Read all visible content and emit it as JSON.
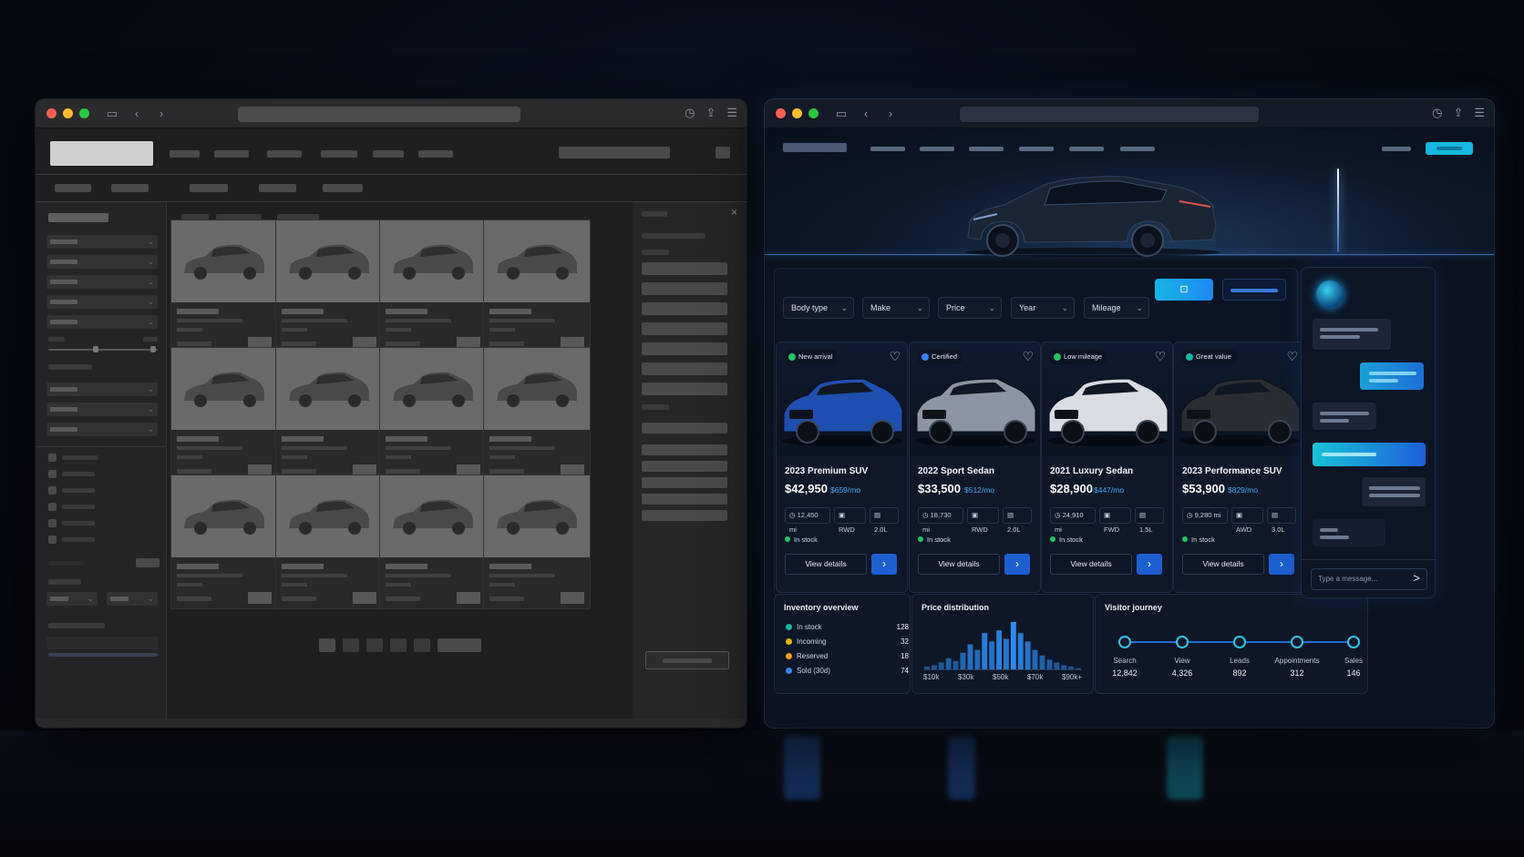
{
  "right_window": {
    "filters": [
      "Body type",
      "Make",
      "Price",
      "Year",
      "Mileage"
    ],
    "cards": [
      {
        "badge": "New arrival",
        "badge_color": "#22c55e",
        "title": "2023 Premium SUV",
        "price": "$42,950",
        "monthly": "$659/mo",
        "mileage": "12,450 mi",
        "drive": "RWD",
        "engine": "2.0L",
        "stock": "In stock",
        "view": "View details",
        "car_color": "#1f4fb0"
      },
      {
        "badge": "Certified",
        "badge_color": "#3b82f6",
        "title": "2022 Sport Sedan",
        "price": "$33,500",
        "monthly": "$512/mo",
        "mileage": "18,730 mi",
        "drive": "RWD",
        "engine": "2.0L",
        "stock": "In stock",
        "view": "View details",
        "car_color": "#8c95a3"
      },
      {
        "badge": "Low mileage",
        "badge_color": "#22c55e",
        "title": "2021 Luxury Sedan",
        "price": "$28,900",
        "monthly": "$447/mo",
        "mileage": "24,910 mi",
        "drive": "FWD",
        "engine": "1.5L",
        "stock": "In stock",
        "view": "View details",
        "car_color": "#d9dde3"
      },
      {
        "badge": "Great value",
        "badge_color": "#14b8a6",
        "title": "2023 Performance SUV",
        "price": "$53,900",
        "monthly": "$829/mo",
        "mileage": "9,280 mi",
        "drive": "AWD",
        "engine": "3.0L",
        "stock": "In stock",
        "view": "View details",
        "car_color": "#2a2d33"
      }
    ],
    "inventory": {
      "title": "Inventory overview",
      "rows": [
        {
          "label": "In stock",
          "value": "128",
          "color": "#14b8a6"
        },
        {
          "label": "Incoming",
          "value": "32",
          "color": "#eab308"
        },
        {
          "label": "Reserved",
          "value": "18",
          "color": "#f59e0b"
        },
        {
          "label": "Sold (30d)",
          "value": "74",
          "color": "#3b82f6"
        }
      ]
    },
    "price_distribution": {
      "title": "Price distribution",
      "axis_labels": [
        "$10k",
        "$30k",
        "$50k",
        "$70k",
        "$90k+"
      ]
    },
    "journey": {
      "title": "Visitor journey",
      "steps": [
        {
          "label": "Search",
          "value": "12,842"
        },
        {
          "label": "View",
          "value": "4,326"
        },
        {
          "label": "Leads",
          "value": "892"
        },
        {
          "label": "Appointments",
          "value": "312"
        },
        {
          "label": "Sales",
          "value": "146"
        }
      ]
    },
    "chat": {
      "placeholder": "Type a message...",
      "send": ">"
    }
  },
  "chart_data": {
    "type": "bar",
    "title": "Price distribution",
    "categories": [
      "$10k",
      "$30k",
      "$50k",
      "$70k",
      "$90k+"
    ],
    "values": [
      2,
      3,
      5,
      8,
      6,
      12,
      18,
      14,
      26,
      20,
      28,
      22,
      34,
      26,
      20,
      14,
      10,
      7,
      5,
      3,
      2,
      1
    ],
    "color": "#2b8cf0"
  }
}
